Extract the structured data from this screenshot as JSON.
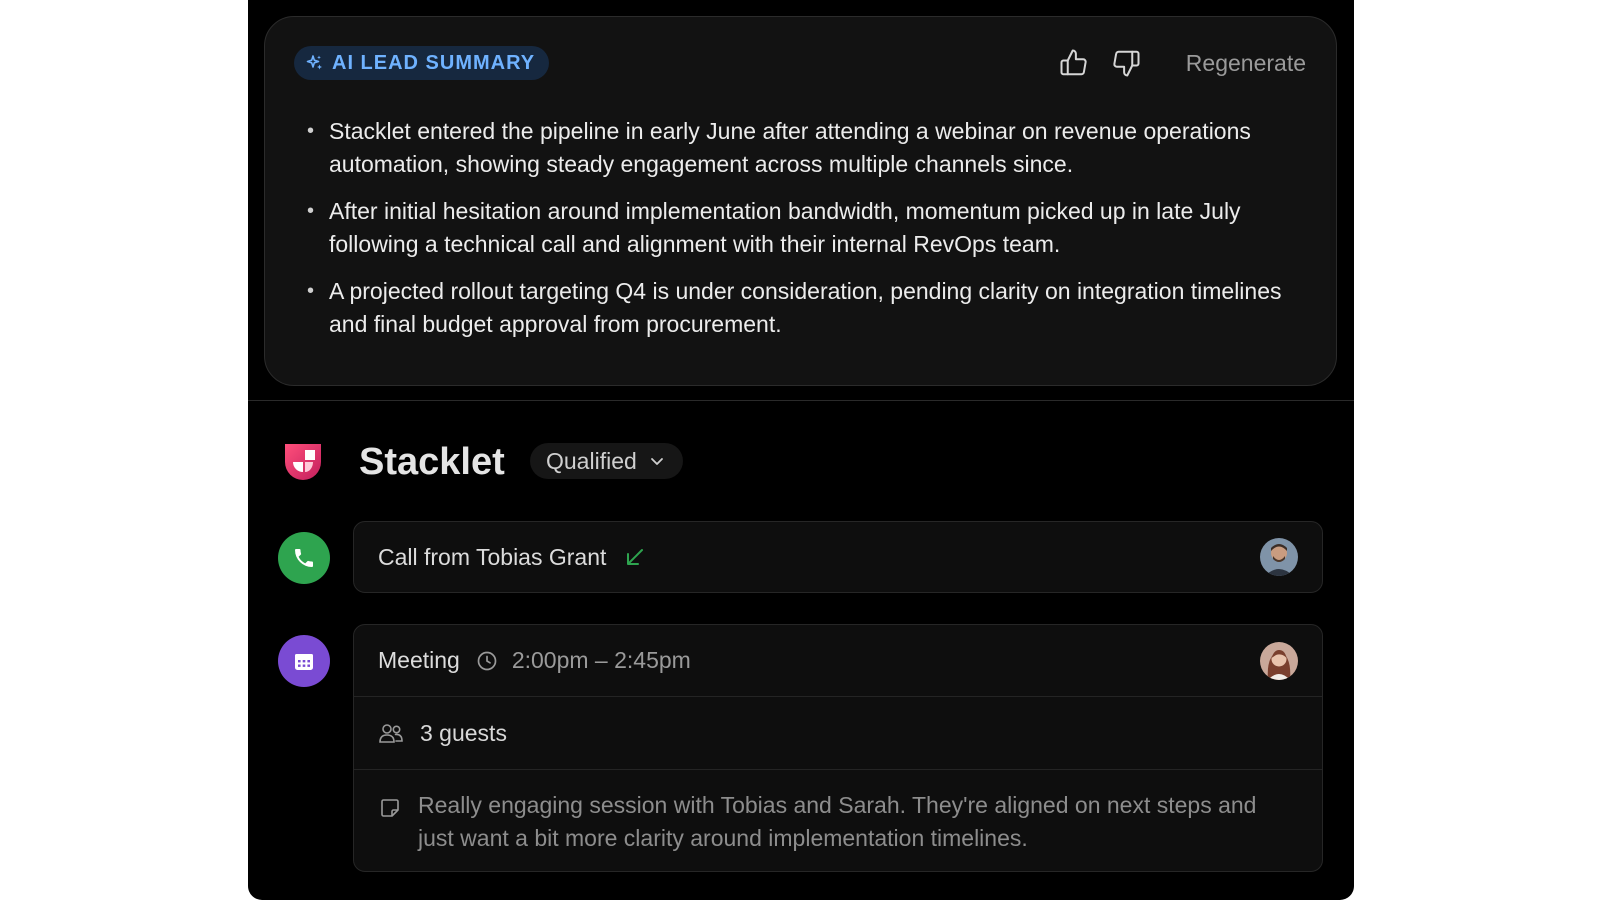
{
  "summary": {
    "badge": "AI LEAD SUMMARY",
    "regenerate_label": "Regenerate",
    "bullets": [
      "Stacklet entered the pipeline in early June after attending a webinar on revenue operations automation, showing steady engagement across multiple channels since.",
      "After initial hesitation around implementation bandwidth, momentum picked up in late July following a technical call and alignment with their internal RevOps team.",
      "A projected rollout targeting Q4 is under consideration, pending clarity on integration timelines and final budget approval from procurement."
    ]
  },
  "company": {
    "name": "Stacklet",
    "status": "Qualified"
  },
  "timeline": {
    "call": {
      "title": "Call from Tobias Grant"
    },
    "meeting": {
      "title": "Meeting",
      "time": "2:00pm – 2:45pm",
      "guests": "3 guests",
      "note": "Really engaging session with Tobias and Sarah. They're aligned on next steps and just want a bit more clarity around implementation timelines."
    }
  },
  "colors": {
    "accent_blue": "#6fb2ff",
    "call_green": "#2ea44f",
    "meeting_purple": "#7a4bd3",
    "logo_pink": "#e3366e"
  },
  "icons": [
    "sparkle-icon",
    "thumbs-up-icon",
    "thumbs-down-icon",
    "chevron-down-icon",
    "phone-icon",
    "incoming-call-arrow-icon",
    "calendar-icon",
    "clock-icon",
    "guests-icon",
    "note-icon"
  ]
}
